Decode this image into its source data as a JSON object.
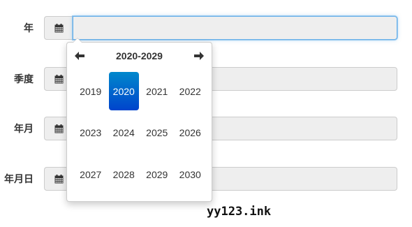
{
  "form": {
    "rows": [
      {
        "label": "年",
        "value": ""
      },
      {
        "label": "季度",
        "value": ""
      },
      {
        "label": "年月",
        "value": ""
      },
      {
        "label": "年月日",
        "value": ""
      }
    ]
  },
  "picker": {
    "title": "2020-2029",
    "prev_icon": "arrow-left-icon",
    "next_icon": "arrow-right-icon",
    "years": [
      "2019",
      "2020",
      "2021",
      "2022",
      "2023",
      "2024",
      "2025",
      "2026",
      "2027",
      "2028",
      "2029",
      "2030"
    ],
    "selected": "2020",
    "accent_color": "#0066cc"
  },
  "watermark": "yy123.ink",
  "icons": {
    "addon": "calendar-icon"
  }
}
